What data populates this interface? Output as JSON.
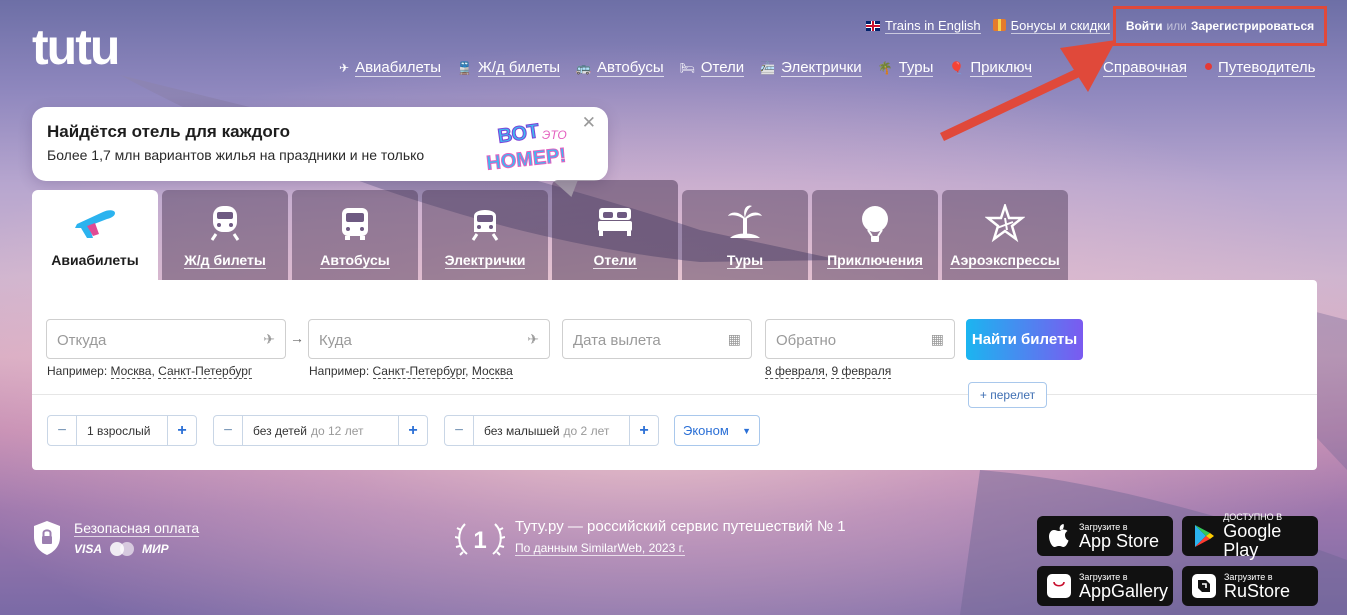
{
  "brand": {
    "logo_text": "tutu"
  },
  "header": {
    "top_links": [
      {
        "label": "Trains in English",
        "icon": "uk-flag-icon"
      },
      {
        "label": "Бонусы и скидки",
        "icon": "gift-icon"
      }
    ],
    "login_label": "Войти",
    "or_label": "или",
    "register_label": "Зарегистрироваться",
    "nav": [
      {
        "label": "Авиабилеты",
        "icon": "plane-icon"
      },
      {
        "label": "Ж/д билеты",
        "icon": "train-icon"
      },
      {
        "label": "Автобусы",
        "icon": "bus-icon"
      },
      {
        "label": "Отели",
        "icon": "bed-icon"
      },
      {
        "label": "Электрички",
        "icon": "suburban-train-icon"
      },
      {
        "label": "Туры",
        "icon": "palm-icon"
      },
      {
        "label": "Приключ",
        "icon": "balloon-icon"
      }
    ],
    "nav_right": [
      {
        "label": "Справочная"
      },
      {
        "label": "Путеводитель",
        "dot_color": "#e53935"
      }
    ]
  },
  "promo": {
    "title": "Найдётся отель для каждого",
    "subtitle": "Более 1,7 млн вариантов жилья на праздники и не только",
    "badge_line1": "ВОТ",
    "badge_line2": "ЭТО",
    "badge_line3": "НОМЕР!",
    "close": "✕"
  },
  "tabs": [
    {
      "label": "Авиабилеты",
      "icon": "plane-icon",
      "active": true
    },
    {
      "label": "Ж/д билеты",
      "icon": "train-icon"
    },
    {
      "label": "Автобусы",
      "icon": "bus-icon"
    },
    {
      "label": "Электрички",
      "icon": "suburban-train-icon"
    },
    {
      "label": "Отели",
      "icon": "bed-icon"
    },
    {
      "label": "Туры",
      "icon": "palm-icon"
    },
    {
      "label": "Приключения",
      "icon": "balloon-icon"
    },
    {
      "label": "Аэроэкспрессы",
      "icon": "aeroexpress-icon"
    }
  ],
  "search": {
    "from_placeholder": "Откуда",
    "to_placeholder": "Куда",
    "date_placeholder": "Дата вылета",
    "return_placeholder": "Обратно",
    "submit_label": "Найти билеты",
    "add_flight_label": "+ перелет",
    "swap_icon": "→",
    "hint_prefix": "Например:",
    "from_hints": [
      "Москва",
      "Санкт-Петербург"
    ],
    "to_hints": [
      "Санкт-Петербург",
      "Москва"
    ],
    "date_hints": [
      "8 февраля",
      "9 февраля"
    ],
    "adults": {
      "value": "1 взрослый"
    },
    "children": {
      "value": "без детей",
      "muted": "до 12 лет"
    },
    "infants": {
      "value": "без малышей",
      "muted": "до 2 лет"
    },
    "minus": "−",
    "plus": "+",
    "class_label": "Эконом",
    "class_caret": "▼"
  },
  "footer": {
    "secure_title": "Безопасная оплата",
    "payment_methods": [
      "VISA",
      "МИР"
    ],
    "rank_number": "1",
    "rank_title": "Туту.ру — российский сервис путешествий № 1",
    "rank_source": "По данным SimilarWeb, 2023 г.",
    "stores": [
      {
        "small": "Загрузите в",
        "big": "App Store",
        "icon": "apple-icon"
      },
      {
        "small": "ДОСТУПНО В",
        "big": "Google Play",
        "icon": "google-play-icon"
      },
      {
        "small": "Загрузите в",
        "big": "AppGallery",
        "icon": "huawei-icon"
      },
      {
        "small": "Загрузите в",
        "big": "RuStore",
        "icon": "rustore-icon"
      }
    ]
  },
  "colors": {
    "accent_red": "#e0493a",
    "button_gradient_start": "#1bb5f0",
    "button_gradient_end": "#7b5af0",
    "link_blue": "#2a6fd6"
  }
}
